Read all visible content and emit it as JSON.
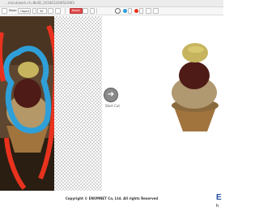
{
  "browser": {
    "url": "...m/cut/work.cf=8k4D_2016612XW52XW3"
  },
  "toolbar": {
    "mode_label": "Mode",
    "mode_value": "Object",
    "brush_value": "30",
    "reset_label": "Reset"
  },
  "editor": {
    "start_cut_label": "Start Cut"
  },
  "footer": {
    "copyright": "Copyright © ENUMNET Co, Ltd. All rights Reserved",
    "brand": "E",
    "brand_sub": "h"
  },
  "colors": {
    "foreground_marker": "#2f9fd8",
    "background_marker": "#e8321e",
    "reset_button": "#e14a4a"
  }
}
